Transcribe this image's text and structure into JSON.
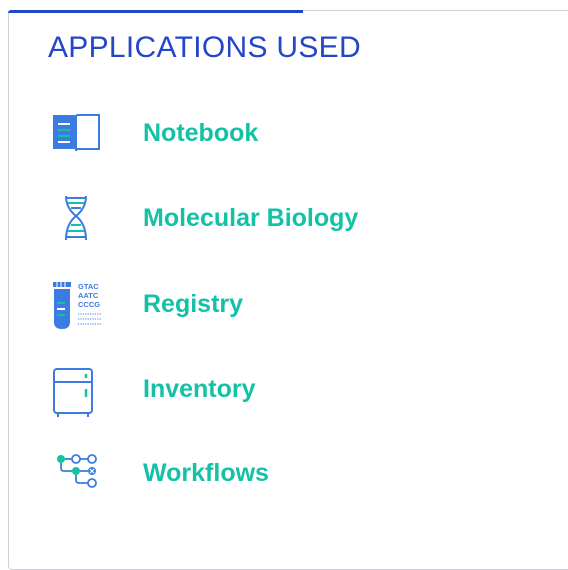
{
  "panel": {
    "title": "APPLICATIONS USED"
  },
  "applications": [
    {
      "label": "Notebook",
      "icon": "notebook-icon"
    },
    {
      "label": "Molecular Biology",
      "icon": "dna-icon"
    },
    {
      "label": "Registry",
      "icon": "registry-icon"
    },
    {
      "label": "Inventory",
      "icon": "freezer-icon"
    },
    {
      "label": "Workflows",
      "icon": "workflow-icon"
    }
  ],
  "registry_icon_text": [
    "GTAC",
    "AATC",
    "CCCG"
  ],
  "colors": {
    "title": "#2446c8",
    "accent_bar": "#2446c8",
    "label": "#13c1a6",
    "icon_blue": "#3c7be0",
    "icon_teal": "#13c1a6",
    "border": "#cfd3d8"
  }
}
